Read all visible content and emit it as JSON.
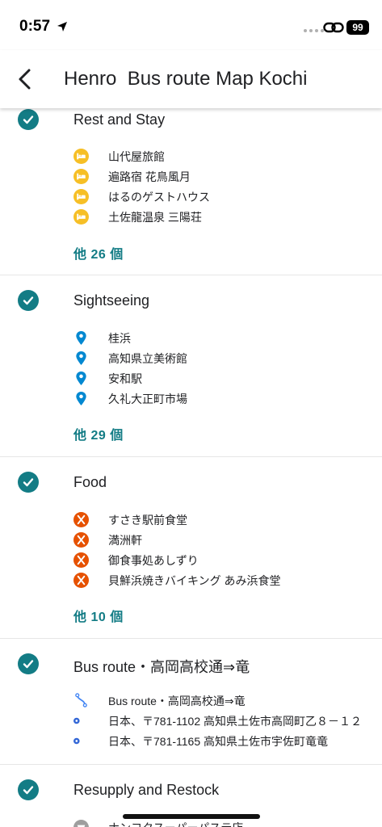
{
  "status_bar": {
    "time": "0:57",
    "battery": "99"
  },
  "app_bar": {
    "title": "Henro  Bus route Map Kochi"
  },
  "colors": {
    "accent": "#137c85",
    "lodging": "#f6bf26",
    "sightseeing": "#0288d1",
    "food": "#e65100",
    "route": "#4285f4"
  },
  "sections": [
    {
      "title": "Rest and Stay",
      "icon": "check-circle-icon",
      "items": [
        {
          "icon": "bed-icon",
          "label": "山代屋旅館"
        },
        {
          "icon": "bed-icon",
          "label": "遍路宿 花鳥風月"
        },
        {
          "icon": "bed-icon",
          "label": "はるのゲストハウス"
        },
        {
          "icon": "bed-icon",
          "label": "土佐龍温泉 三陽荘"
        }
      ],
      "more": "他 26 個"
    },
    {
      "title": "Sightseeing",
      "icon": "check-circle-icon",
      "items": [
        {
          "icon": "map-pin-icon",
          "label": "桂浜"
        },
        {
          "icon": "map-pin-icon",
          "label": "高知県立美術館"
        },
        {
          "icon": "map-pin-icon",
          "label": "安和駅"
        },
        {
          "icon": "map-pin-icon",
          "label": "久礼大正町市場"
        }
      ],
      "more": "他 29 個"
    },
    {
      "title": "Food",
      "icon": "check-circle-icon",
      "items": [
        {
          "icon": "fork-knife-icon",
          "label": "すさき駅前食堂"
        },
        {
          "icon": "fork-knife-icon",
          "label": "満洲軒"
        },
        {
          "icon": "fork-knife-icon",
          "label": "御食事処あしずり"
        },
        {
          "icon": "fork-knife-icon",
          "label": "貝鮮浜焼きバイキング あみ浜食堂"
        }
      ],
      "more": "他 10 個"
    },
    {
      "title": "Bus route・高岡高校通⇒竜",
      "icon": "check-circle-icon",
      "items": [
        {
          "icon": "route-icon",
          "label": "Bus route・高岡高校通⇒竜"
        },
        {
          "icon": "point-a-icon",
          "label": "日本、〒781-1102 高知県土佐市高岡町乙８－１２"
        },
        {
          "icon": "point-b-icon",
          "label": "日本、〒781-1165 高知県土佐市宇佐町竜竜"
        }
      ]
    },
    {
      "title": "Resupply and Restock",
      "icon": "check-circle-icon",
      "items": [
        {
          "icon": "shop-icon",
          "label": "ナンコクスーパーパステ店"
        }
      ]
    }
  ]
}
